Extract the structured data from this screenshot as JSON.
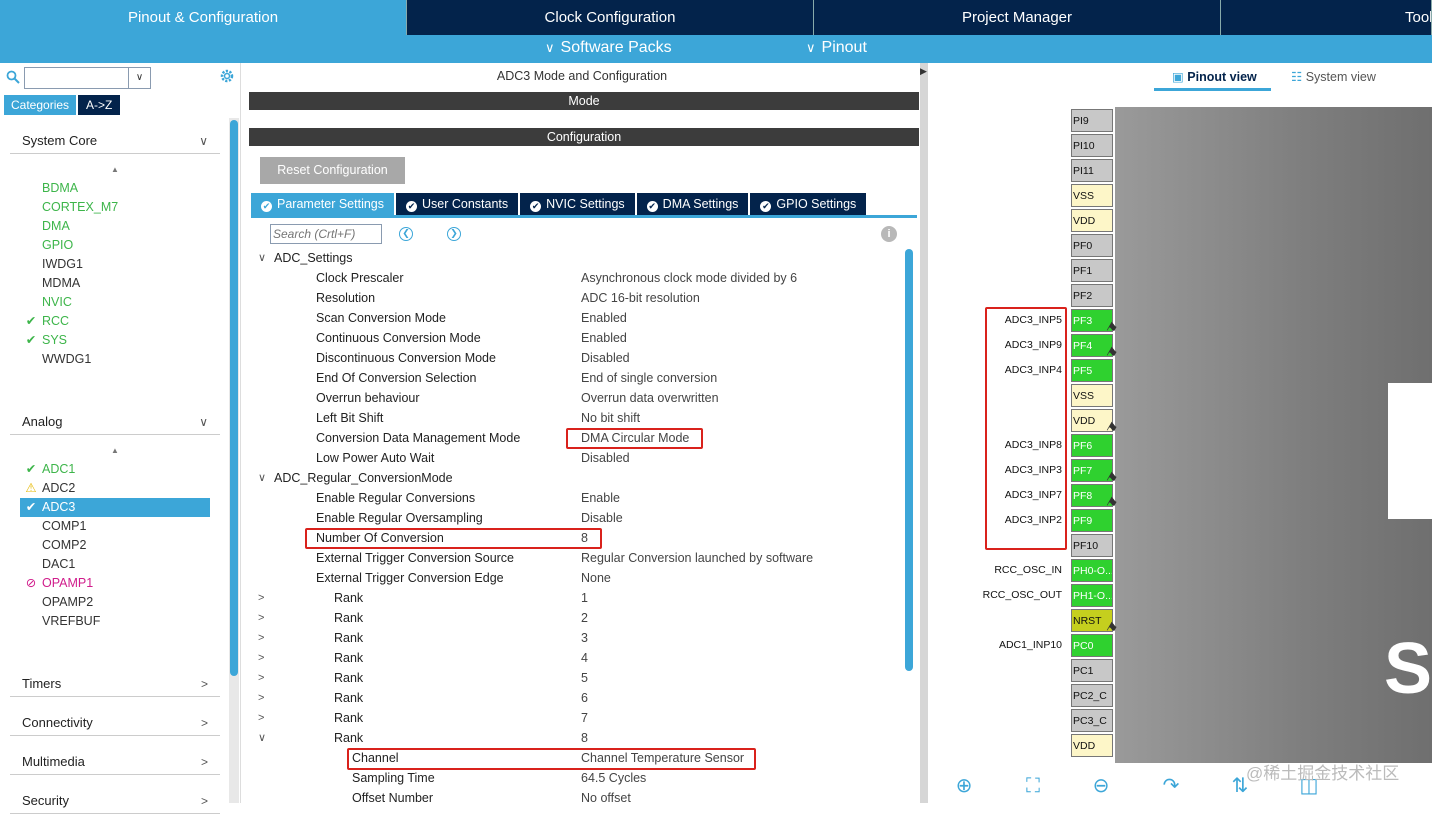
{
  "top_tabs": [
    "Pinout & Configuration",
    "Clock Configuration",
    "Project Manager",
    "Tools"
  ],
  "sub_menu": {
    "software_packs": "Software Packs",
    "pinout": "Pinout"
  },
  "sidebar": {
    "search_value": "",
    "tabs": [
      "Categories",
      "A->Z"
    ],
    "system_core": {
      "title": "System Core",
      "items": [
        {
          "label": "BDMA",
          "state": "green"
        },
        {
          "label": "CORTEX_M7",
          "state": "green"
        },
        {
          "label": "DMA",
          "state": "green"
        },
        {
          "label": "GPIO",
          "state": "green"
        },
        {
          "label": "IWDG1",
          "state": "normal"
        },
        {
          "label": "MDMA",
          "state": "normal"
        },
        {
          "label": "NVIC",
          "state": "green"
        },
        {
          "label": "RCC",
          "state": "check"
        },
        {
          "label": "SYS",
          "state": "check"
        },
        {
          "label": "WWDG1",
          "state": "normal"
        }
      ]
    },
    "analog": {
      "title": "Analog",
      "items": [
        {
          "label": "ADC1",
          "state": "check"
        },
        {
          "label": "ADC2",
          "state": "warning"
        },
        {
          "label": "ADC3",
          "state": "selected"
        },
        {
          "label": "COMP1",
          "state": "normal"
        },
        {
          "label": "COMP2",
          "state": "normal"
        },
        {
          "label": "DAC1",
          "state": "normal"
        },
        {
          "label": "OPAMP1",
          "state": "disabled"
        },
        {
          "label": "OPAMP2",
          "state": "normal"
        },
        {
          "label": "VREFBUF",
          "state": "normal"
        }
      ]
    },
    "groups": [
      "Timers",
      "Connectivity",
      "Multimedia",
      "Security"
    ]
  },
  "middle": {
    "title": "ADC3 Mode and Configuration",
    "mode_bar": "Mode",
    "config_bar": "Configuration",
    "reset_button": "Reset Configuration",
    "param_tabs": [
      "Parameter Settings",
      "User Constants",
      "NVIC Settings",
      "DMA Settings",
      "GPIO Settings"
    ],
    "search_placeholder": "Search (Crtl+F)",
    "rows": [
      {
        "name": "ADC_Settings",
        "value": "",
        "indent": 0,
        "chev": "v"
      },
      {
        "name": "Clock Prescaler",
        "value": "Asynchronous clock mode divided by 6",
        "indent": 1
      },
      {
        "name": "Resolution",
        "value": "ADC 16-bit resolution",
        "indent": 1
      },
      {
        "name": "Scan Conversion Mode",
        "value": "Enabled",
        "indent": 1
      },
      {
        "name": "Continuous Conversion Mode",
        "value": "Enabled",
        "indent": 1
      },
      {
        "name": "Discontinuous Conversion Mode",
        "value": "Disabled",
        "indent": 1
      },
      {
        "name": "End Of Conversion Selection",
        "value": "End of single conversion",
        "indent": 1
      },
      {
        "name": "Overrun behaviour",
        "value": "Overrun data overwritten",
        "indent": 1
      },
      {
        "name": "Left Bit Shift",
        "value": "No bit shift",
        "indent": 1
      },
      {
        "name": "Conversion Data Management Mode",
        "value": "DMA Circular Mode",
        "indent": 1
      },
      {
        "name": "Low Power Auto Wait",
        "value": "Disabled",
        "indent": 1
      },
      {
        "name": "ADC_Regular_ConversionMode",
        "value": "",
        "indent": 0,
        "chev": "v"
      },
      {
        "name": "Enable Regular Conversions",
        "value": "Enable",
        "indent": 1
      },
      {
        "name": "Enable Regular Oversampling",
        "value": "Disable",
        "indent": 1
      },
      {
        "name": "Number Of Conversion",
        "value": "8",
        "indent": 1
      },
      {
        "name": "External Trigger Conversion Source",
        "value": "Regular Conversion launched by software",
        "indent": 1
      },
      {
        "name": "External Trigger Conversion Edge",
        "value": "None",
        "indent": 1
      },
      {
        "name": "Rank",
        "value": "1",
        "indent": 2,
        "chev": ">"
      },
      {
        "name": "Rank",
        "value": "2",
        "indent": 2,
        "chev": ">"
      },
      {
        "name": "Rank",
        "value": "3",
        "indent": 2,
        "chev": ">"
      },
      {
        "name": "Rank",
        "value": "4",
        "indent": 2,
        "chev": ">"
      },
      {
        "name": "Rank",
        "value": "5",
        "indent": 2,
        "chev": ">"
      },
      {
        "name": "Rank",
        "value": "6",
        "indent": 2,
        "chev": ">"
      },
      {
        "name": "Rank",
        "value": "7",
        "indent": 2,
        "chev": ">"
      },
      {
        "name": "Rank",
        "value": "8",
        "indent": 2,
        "chev": "v"
      },
      {
        "name": "Channel",
        "value": "Channel Temperature Sensor",
        "indent": 3
      },
      {
        "name": "Sampling Time",
        "value": "64.5 Cycles",
        "indent": 3
      },
      {
        "name": "Offset Number",
        "value": "No offset",
        "indent": 3
      }
    ]
  },
  "right": {
    "tabs": [
      "Pinout view",
      "System view"
    ],
    "pins": [
      {
        "name": "PI9",
        "color": "gray",
        "label": ""
      },
      {
        "name": "PI10",
        "color": "gray",
        "label": ""
      },
      {
        "name": "PI11",
        "color": "gray",
        "label": ""
      },
      {
        "name": "VSS",
        "color": "yellow",
        "label": ""
      },
      {
        "name": "VDD",
        "color": "yellow",
        "label": ""
      },
      {
        "name": "PF0",
        "color": "gray",
        "label": ""
      },
      {
        "name": "PF1",
        "color": "gray",
        "label": ""
      },
      {
        "name": "PF2",
        "color": "gray",
        "label": ""
      },
      {
        "name": "PF3",
        "color": "green",
        "label": "ADC3_INP5",
        "pinned": true
      },
      {
        "name": "PF4",
        "color": "green",
        "label": "ADC3_INP9",
        "pinned": true
      },
      {
        "name": "PF5",
        "color": "green",
        "label": "ADC3_INP4"
      },
      {
        "name": "VSS",
        "color": "yellow",
        "label": ""
      },
      {
        "name": "VDD",
        "color": "yellow",
        "label": "",
        "pinned": true
      },
      {
        "name": "PF6",
        "color": "green",
        "label": "ADC3_INP8"
      },
      {
        "name": "PF7",
        "color": "green",
        "label": "ADC3_INP3",
        "pinned": true
      },
      {
        "name": "PF8",
        "color": "green",
        "label": "ADC3_INP7",
        "pinned": true
      },
      {
        "name": "PF9",
        "color": "green",
        "label": "ADC3_INP2"
      },
      {
        "name": "PF10",
        "color": "gray",
        "label": ""
      },
      {
        "name": "PH0-O...",
        "color": "green",
        "label": "RCC_OSC_IN"
      },
      {
        "name": "PH1-O...",
        "color": "green",
        "label": "RCC_OSC_OUT"
      },
      {
        "name": "NRST",
        "color": "olive",
        "label": "",
        "pinned": true
      },
      {
        "name": "PC0",
        "color": "green",
        "label": "ADC1_INP10"
      },
      {
        "name": "PC1",
        "color": "gray",
        "label": ""
      },
      {
        "name": "PC2_C",
        "color": "gray",
        "label": ""
      },
      {
        "name": "PC3_C",
        "color": "gray",
        "label": ""
      },
      {
        "name": "VDD",
        "color": "yellow",
        "label": ""
      }
    ],
    "chip_letter": "S",
    "watermark": "@稀土掘金技术社区"
  }
}
